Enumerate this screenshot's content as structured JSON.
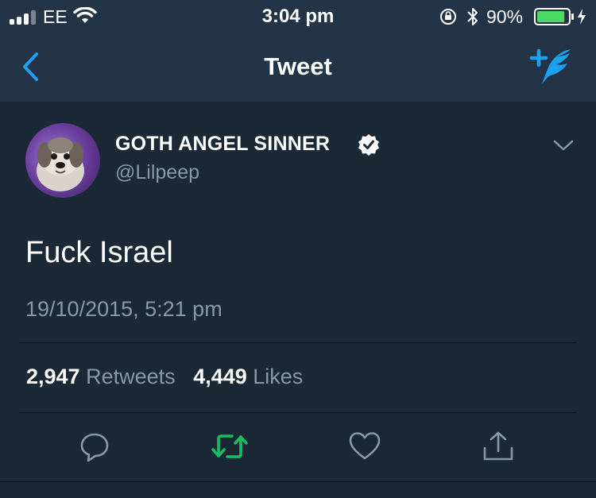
{
  "status_bar": {
    "carrier": "EE",
    "time": "3:04 pm",
    "battery_percent": "90%",
    "battery_level": 0.9
  },
  "nav": {
    "title": "Tweet"
  },
  "tweet": {
    "display_name": "GOTH ANGEL SINNER",
    "handle": "@Lilpeep",
    "text": "Fuck Israel",
    "timestamp": "19/10/2015, 5:21 pm",
    "retweets_count": "2,947",
    "retweets_label": "Retweets",
    "likes_count": "4,449",
    "likes_label": "Likes"
  },
  "colors": {
    "accent_blue": "#1da1f2",
    "retweet_green": "#17bf63",
    "muted_text": "#8899a6",
    "background": "#1b2836",
    "header_background": "#243447"
  },
  "icons": [
    "back-chevron-icon",
    "compose-tweet-icon",
    "verified-badge-icon",
    "chevron-down-icon",
    "reply-icon",
    "retweet-icon",
    "like-icon",
    "share-icon"
  ]
}
